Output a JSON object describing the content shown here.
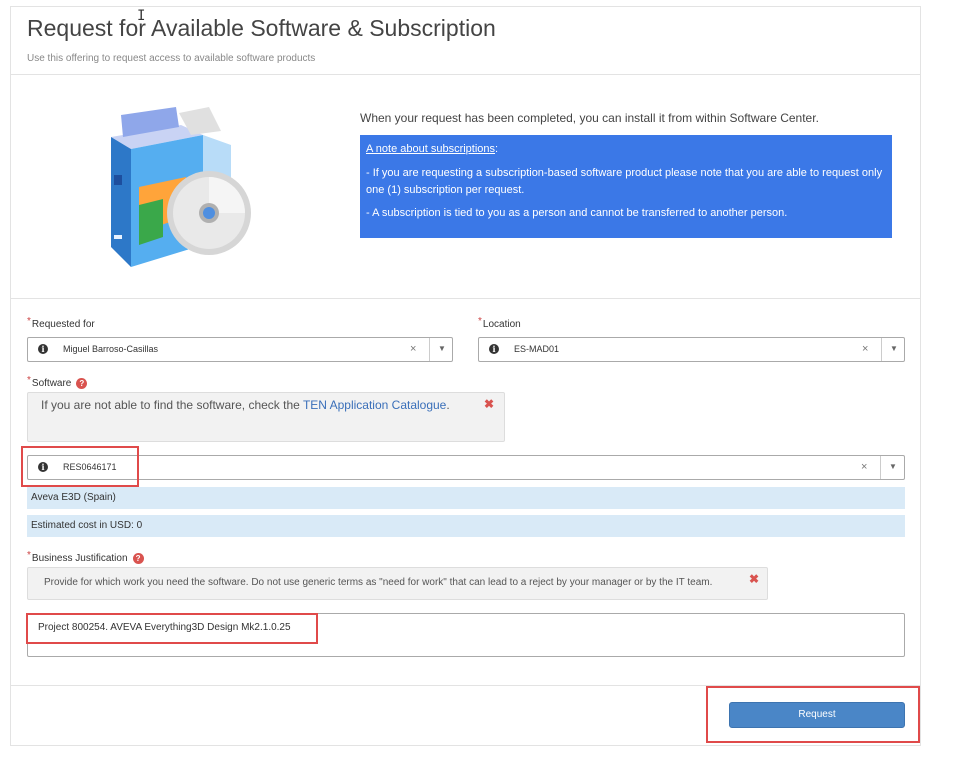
{
  "header": {
    "title": "Request for Available Software & Subscription",
    "subtitle": "Use this offering to request access to available software products"
  },
  "intro": {
    "completed_text": "When your request has been completed, you can install it from within Software Center.",
    "note": {
      "title": "A note about subscriptions",
      "title_suffix": ":",
      "line1": "- If you are requesting a subscription-based software product please note that you are able to request only one (1) subscription per request.",
      "line2": "- A subscription is tied to you as a person and cannot be transferred to another person."
    },
    "accent_color": "#3b78e7"
  },
  "form": {
    "required_mark": "*",
    "requested_for": {
      "label": "Requested for",
      "value": "Miguel Barroso-Casillas"
    },
    "location": {
      "label": "Location",
      "value": "ES-MAD01"
    },
    "software": {
      "label": "Software",
      "warning_prefix": "If you are not able to find the software, check the ",
      "warning_link": "TEN Application Catalogue",
      "warning_suffix": ".",
      "value": "RES0646171",
      "product_name": "Aveva E3D (Spain)",
      "estimated_cost": "Estimated cost in USD: 0"
    },
    "justification": {
      "label": "Business Justification",
      "warning": "Provide for which work you need the software. Do not use generic terms as \"need for work\" that can lead to a reject by your manager or by the IT team.",
      "value": "Project 800254. AVEVA Everything3D Design Mk2.1.0.25"
    }
  },
  "icons": {
    "info": "i",
    "clear": "×",
    "caret": "▼",
    "close": "✖",
    "help": "?"
  },
  "actions": {
    "request_label": "Request"
  },
  "colors": {
    "highlight": "#e04a4a",
    "info_bar": "#d9eaf7",
    "button": "#4a86c7",
    "error": "#d9534f"
  }
}
